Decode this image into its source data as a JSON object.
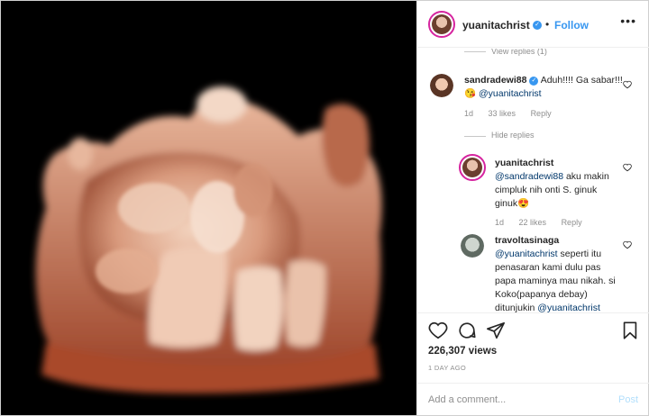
{
  "post": {
    "author": "yuanitachrist",
    "follow_label": "Follow",
    "dot": "•",
    "more": "•••",
    "verified_mark": "✓"
  },
  "comments": {
    "view_replies_cut": "View replies (1)",
    "items": [
      {
        "user": "sandradewi88",
        "verified": true,
        "text_plain": "Aduh!!!! Ga sabar!!! 😘 ",
        "mention": "@yuanitachrist",
        "time": "1d",
        "likes": "33 likes",
        "reply": "Reply"
      }
    ],
    "hide_replies": "Hide replies",
    "replies": [
      {
        "user": "yuanitachrist",
        "mention": "@sandradewi88",
        "text_plain": " aku makin cimpluk nih onti S. ginuk ginuk😍",
        "time": "1d",
        "likes": "22 likes",
        "reply": "Reply"
      },
      {
        "user": "travoltasinaga",
        "mention": "@yuanitachrist",
        "text_plain": " seperti itu penasaran kami dulu pas papa maminya mau nikah. si Koko(papanya debay) ditunjukin ",
        "mention_end": "@yuanitachrist"
      }
    ]
  },
  "stats": {
    "views": "226,307 views",
    "time_ago": "1 DAY AGO"
  },
  "composer": {
    "placeholder": "Add a comment...",
    "post_label": "Post"
  },
  "icons": {
    "like": "heart-icon",
    "comment": "comment-icon",
    "share": "share-icon",
    "save": "bookmark-icon"
  },
  "colors": {
    "link_blue": "#3897f0",
    "mention": "#00376b",
    "muted": "#8e8e8e",
    "post_disabled": "#b2dffc",
    "story_ring": "#d6249f"
  }
}
